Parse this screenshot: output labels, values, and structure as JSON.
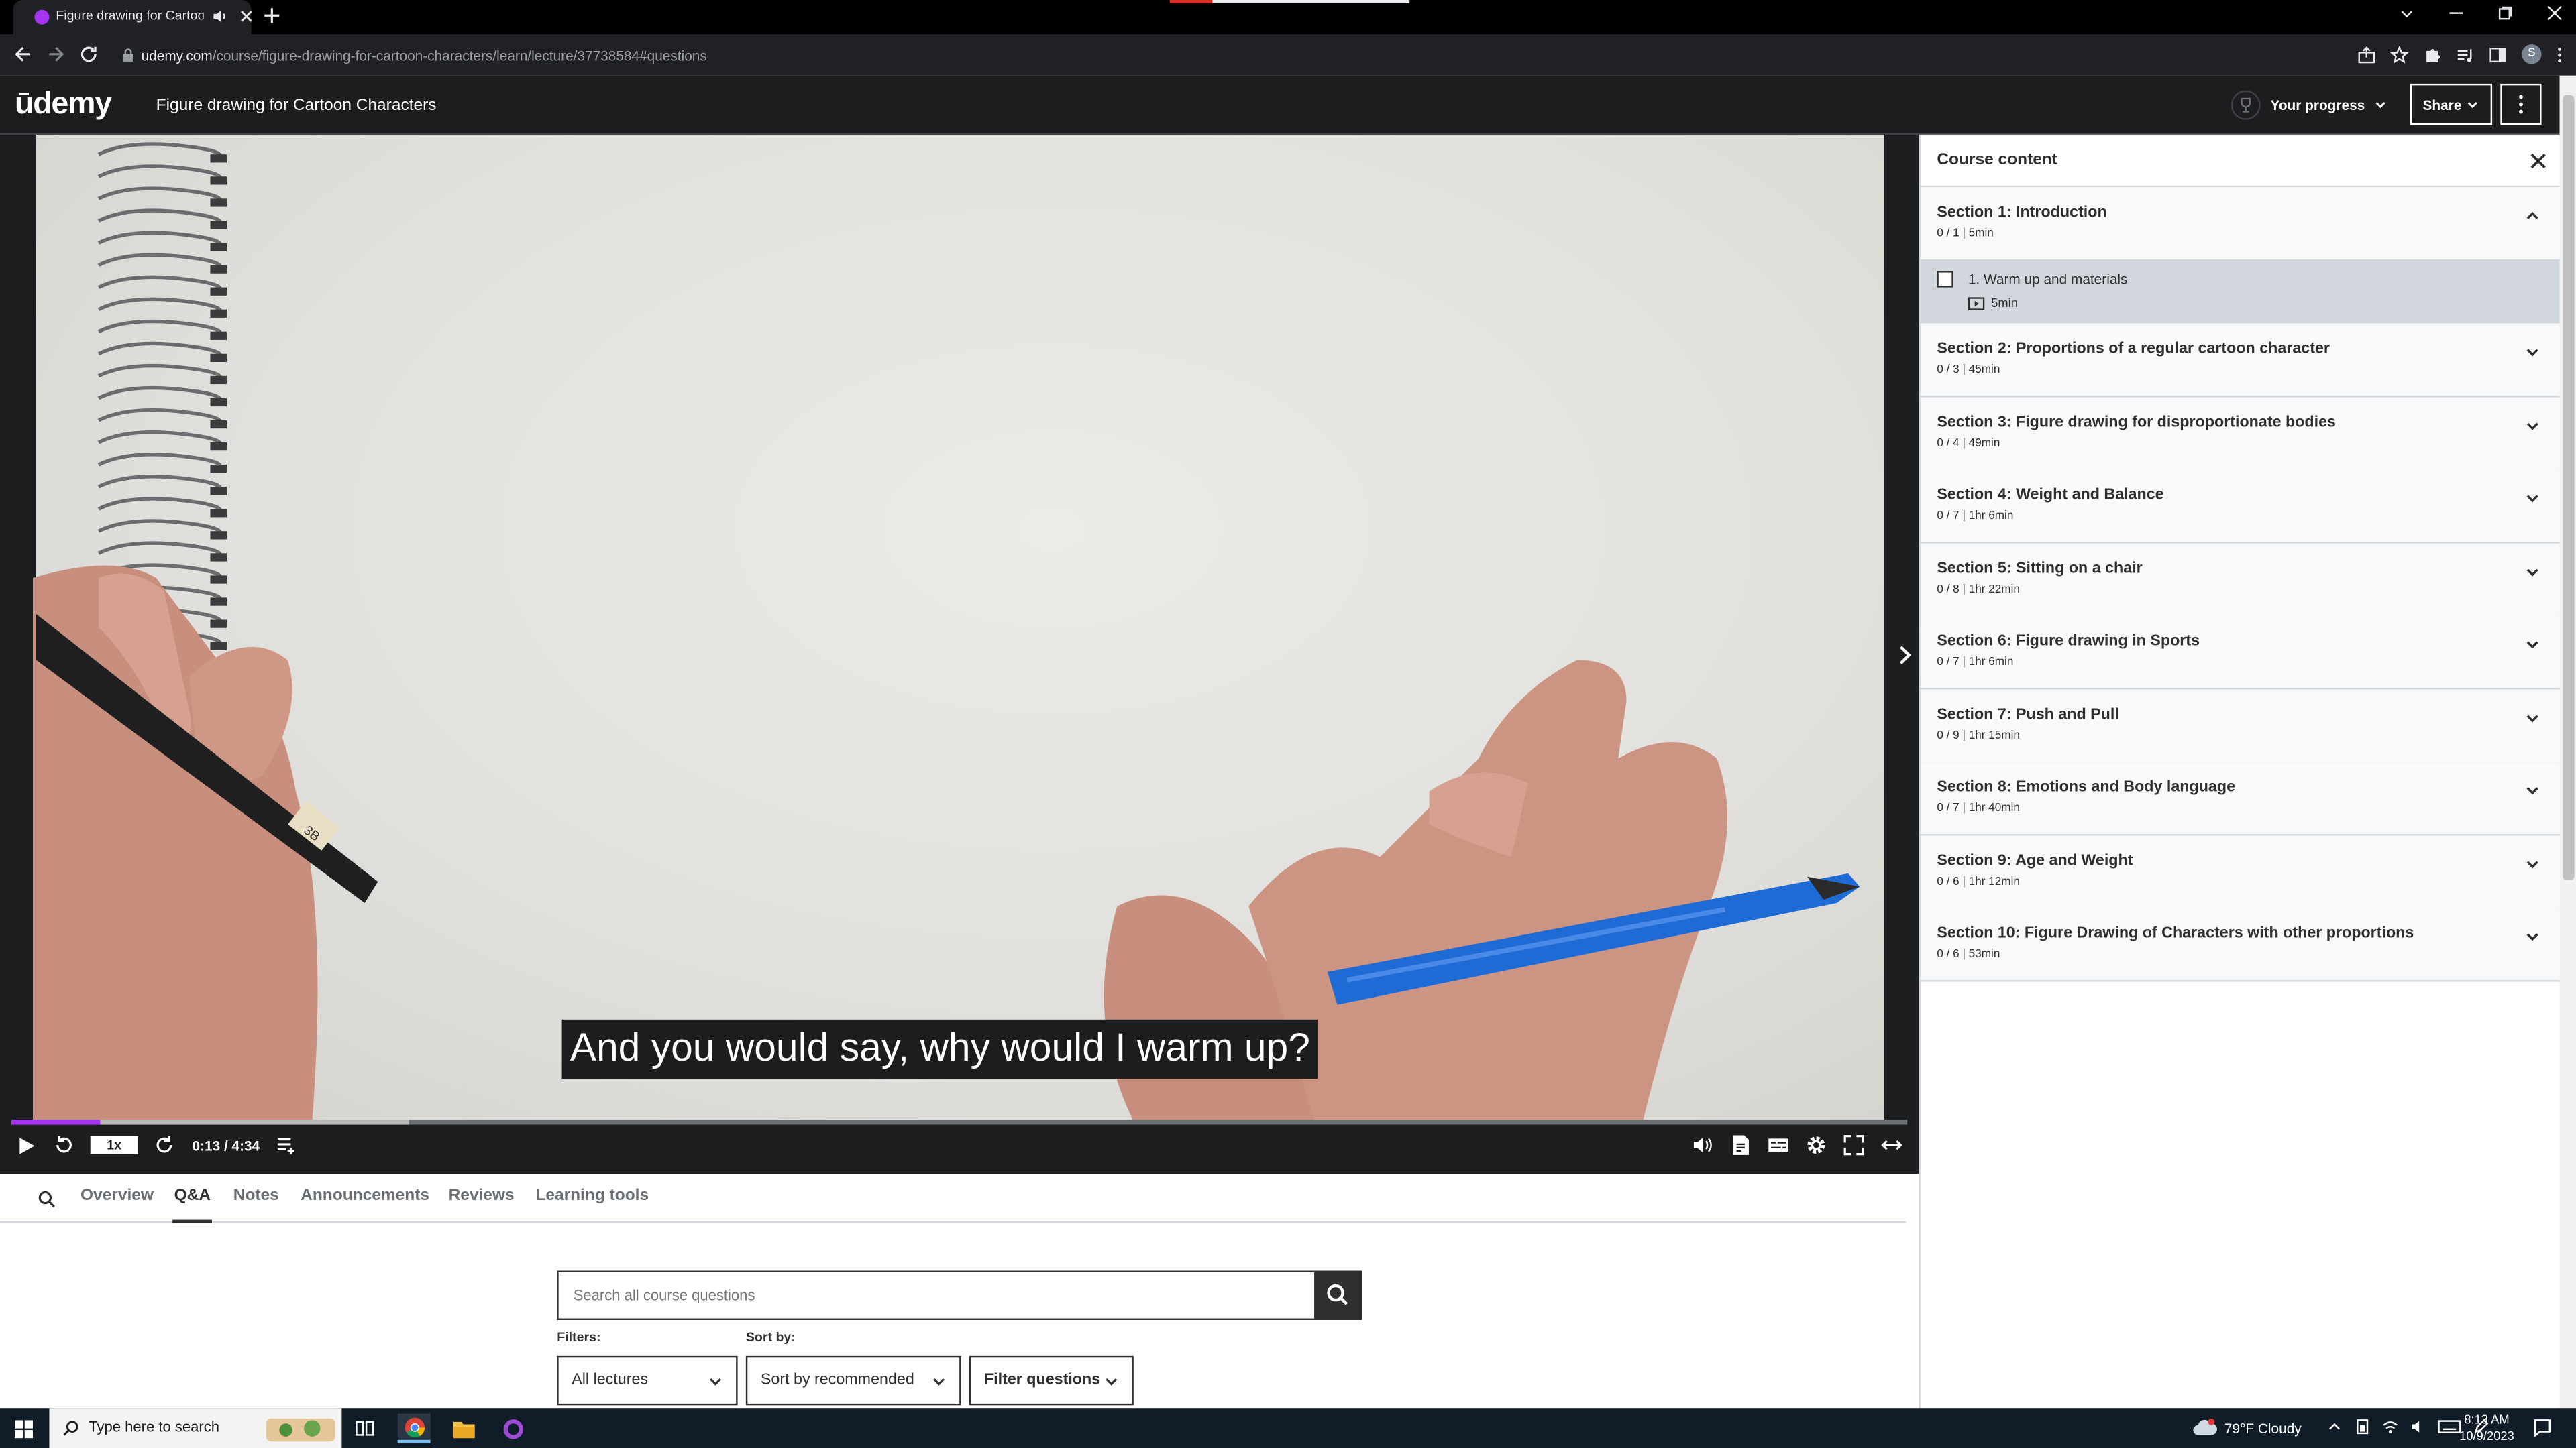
{
  "browser": {
    "tab_title": "Figure drawing for Cartoon",
    "url_host": "udemy.com",
    "url_path": "/course/figure-drawing-for-cartoon-characters/learn/lecture/37738584#questions"
  },
  "header": {
    "logo": "ūdemy",
    "course_title": "Figure drawing for Cartoon Characters",
    "progress_label": "Your progress",
    "share_label": "Share"
  },
  "player": {
    "caption": "And you would say, why would I warm up?",
    "speed": "1x",
    "time": "0:13 / 4:34",
    "progress_fraction": 0.047,
    "buffered_fraction": 0.21,
    "pencil_label": "3B"
  },
  "sidebar": {
    "title": "Course content",
    "sections": [
      {
        "title": "Section 1: Introduction",
        "meta": "0 / 1 | 5min",
        "expanded": true
      },
      {
        "title": "Section 2: Proportions of a regular cartoon character",
        "meta": "0 / 3 | 45min"
      },
      {
        "title": "Section 3: Figure drawing for disproportionate bodies",
        "meta": "0 / 4 | 49min"
      },
      {
        "title": "Section 4: Weight and Balance",
        "meta": "0 / 7 | 1hr 6min"
      },
      {
        "title": "Section 5: Sitting on a chair",
        "meta": "0 / 8 | 1hr 22min"
      },
      {
        "title": "Section 6: Figure drawing in Sports",
        "meta": "0 / 7 | 1hr 6min"
      },
      {
        "title": "Section 7: Push and Pull",
        "meta": "0 / 9 | 1hr 15min"
      },
      {
        "title": "Section 8: Emotions and Body language",
        "meta": "0 / 7 | 1hr 40min"
      },
      {
        "title": "Section 9: Age and Weight",
        "meta": "0 / 6 | 1hr 12min"
      },
      {
        "title": "Section 10: Figure Drawing of Characters with other proportions",
        "meta": "0 / 6 | 53min"
      }
    ],
    "lecture": {
      "title": "1. Warm up and materials",
      "duration": "5min"
    }
  },
  "tabs": [
    "Overview",
    "Q&A",
    "Notes",
    "Announcements",
    "Reviews",
    "Learning tools"
  ],
  "active_tab": "Q&A",
  "qa": {
    "search_placeholder": "Search all course questions",
    "filters_label": "Filters:",
    "sortby_label": "Sort by:",
    "filter_lectures": "All lectures",
    "sort_value": "Sort by recommended",
    "filter_questions": "Filter questions"
  },
  "taskbar": {
    "search_placeholder": "Type here to search",
    "weather": "79°F  Cloudy",
    "time": "8:13 AM",
    "date": "10/9/2023"
  },
  "colors": {
    "accent": "#a435f0",
    "header_bg": "#1c1d1f",
    "taskbar_bg": "#101c28"
  }
}
